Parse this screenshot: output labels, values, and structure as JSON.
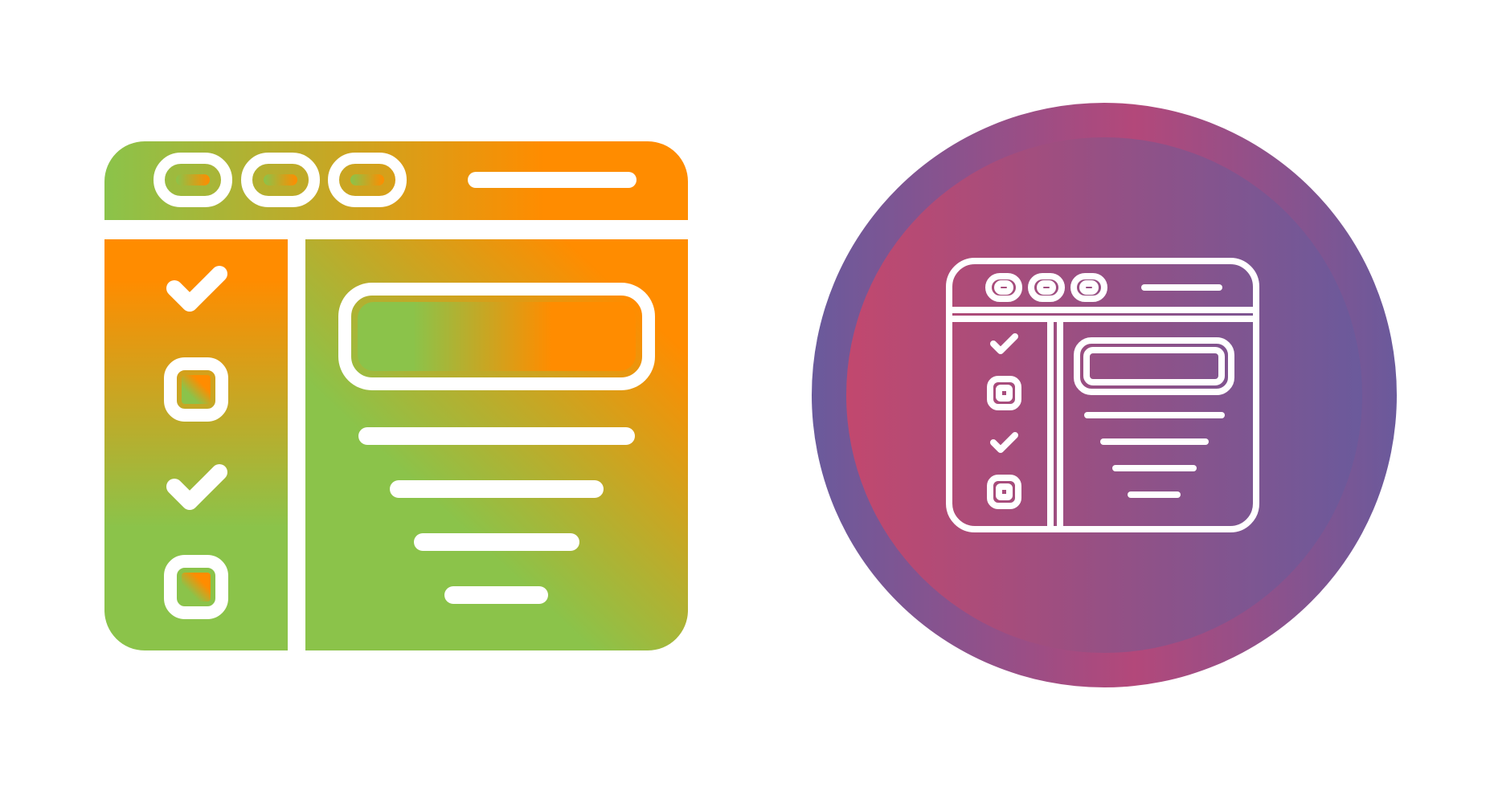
{
  "icons": [
    {
      "name": "checklist-browser-icon",
      "style": "glyph-gradient",
      "gradient_colors": [
        "#8bc34a",
        "#ff8c00"
      ],
      "checklist": [
        "checked",
        "unchecked",
        "checked",
        "unchecked"
      ]
    },
    {
      "name": "checklist-browser-icon",
      "style": "line-on-circle",
      "circle_gradient_colors": [
        "#6a5a9c",
        "#c0466e"
      ],
      "line_color": "#ffffff",
      "checklist": [
        "checked",
        "unchecked",
        "checked",
        "unchecked"
      ]
    }
  ]
}
